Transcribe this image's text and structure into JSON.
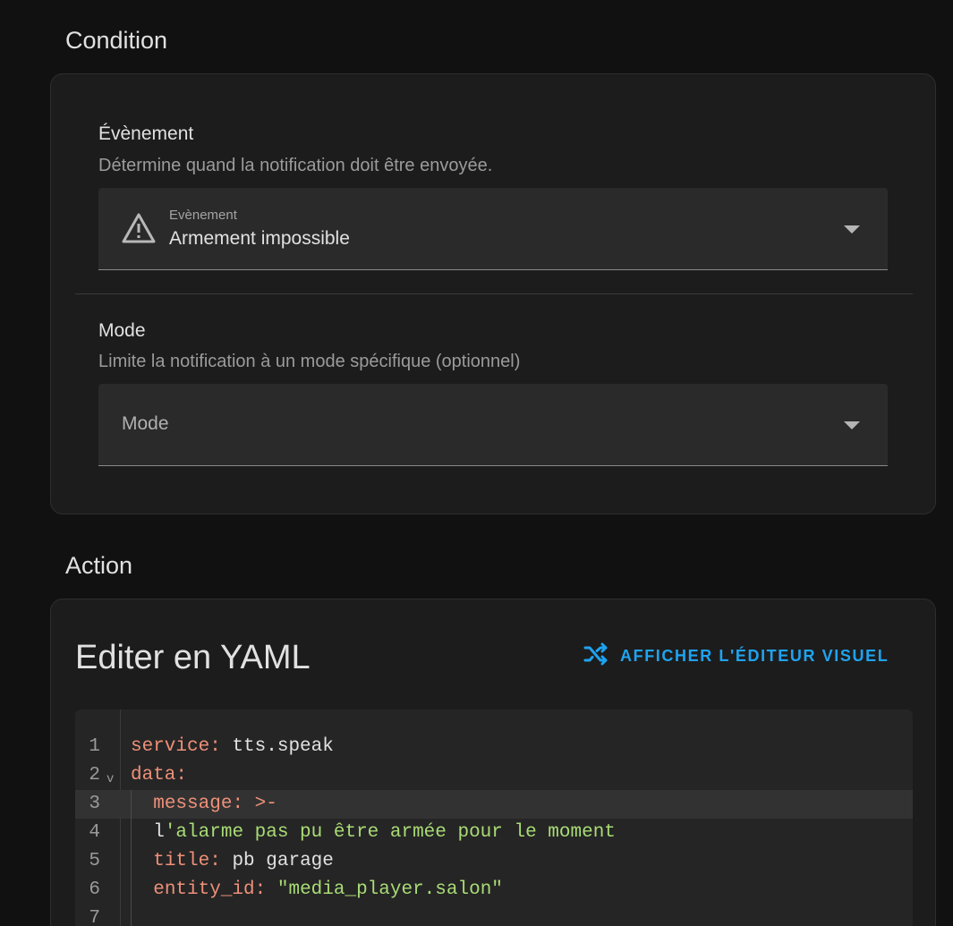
{
  "condition": {
    "heading": "Condition",
    "event": {
      "title": "Évènement",
      "description": "Détermine quand la notification doit être envoyée.",
      "select_label": "Evènement",
      "select_value": "Armement impossible"
    },
    "mode": {
      "title": "Mode",
      "description": "Limite la notification à un mode spécifique (optionnel)",
      "select_placeholder": "Mode"
    }
  },
  "action": {
    "heading": "Action",
    "editor_title": "Editer en YAML",
    "visual_editor_button": "AFFICHER L'ÉDITEUR VISUEL",
    "accent_color": "#1fa3f0",
    "code_lines": [
      {
        "num": "1",
        "key": "service",
        "sep": ": ",
        "val": "tts.speak"
      },
      {
        "num": "2",
        "key": "data",
        "sep": ":",
        "val": ""
      },
      {
        "num": "3",
        "indent": "  ",
        "key": "message",
        "sep": ": ",
        "val": ">-"
      },
      {
        "num": "4",
        "indent": "  ",
        "pre": "l",
        "str": "'alarme pas pu être armée pour le moment"
      },
      {
        "num": "5",
        "indent": "  ",
        "key": "title",
        "sep": ": ",
        "val": "pb garage"
      },
      {
        "num": "6",
        "indent": "  ",
        "key": "entity_id",
        "sep": ": ",
        "val": "\"media_player.salon\""
      },
      {
        "num": "7"
      }
    ]
  }
}
